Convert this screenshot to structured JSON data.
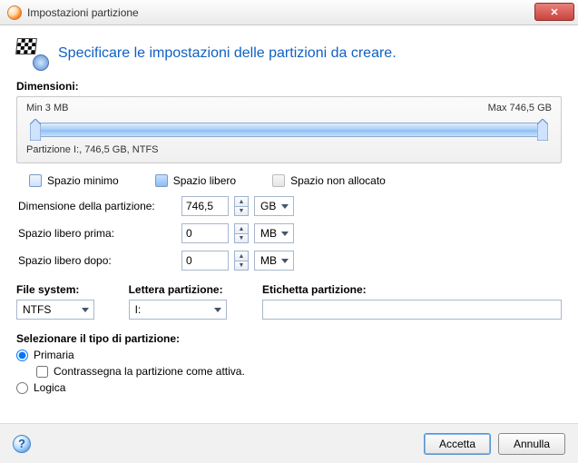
{
  "window": {
    "title": "Impostazioni partizione"
  },
  "header": {
    "text": "Specificare le impostazioni delle partizioni da creare."
  },
  "size": {
    "section_label": "Dimensioni:",
    "min_label": "Min 3 MB",
    "max_label": "Max 746,5 GB",
    "caption": "Partizione I:, 746,5 GB, NTFS"
  },
  "legend": {
    "min": "Spazio minimo",
    "free": "Spazio libero",
    "unalloc": "Spazio non allocato"
  },
  "fields": {
    "partition_size_label": "Dimensione della partizione:",
    "partition_size_value": "746,5",
    "partition_size_unit": "GB",
    "free_before_label": "Spazio libero prima:",
    "free_before_value": "0",
    "free_before_unit": "MB",
    "free_after_label": "Spazio libero dopo:",
    "free_after_value": "0",
    "free_after_unit": "MB"
  },
  "fs": {
    "filesystem_label": "File system:",
    "filesystem_value": "NTFS",
    "letter_label": "Lettera partizione:",
    "letter_value": "I:",
    "volume_label_label": "Etichetta partizione:",
    "volume_label_value": ""
  },
  "ptype": {
    "section_label": "Selezionare il tipo di partizione:",
    "primary_label": "Primaria",
    "active_label": "Contrassegna la partizione come attiva.",
    "logical_label": "Logica",
    "selected": "primary",
    "active_checked": false
  },
  "footer": {
    "accept": "Accetta",
    "cancel": "Annulla"
  }
}
